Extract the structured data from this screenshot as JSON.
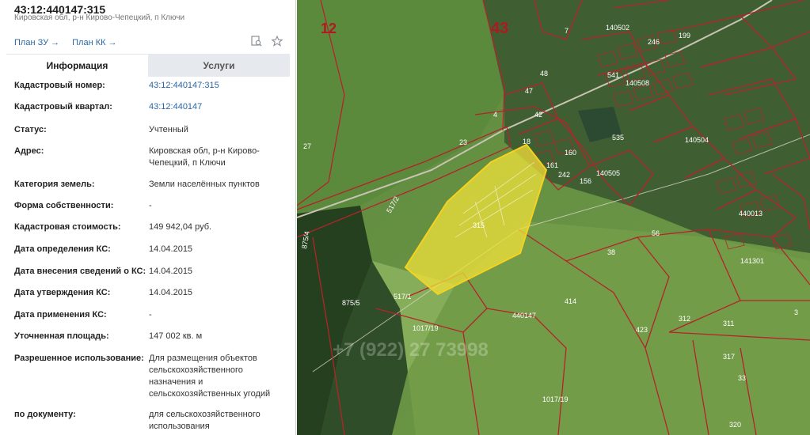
{
  "header": {
    "title": "43:12:440147:315",
    "subtitle": "Кировская обл, р-н Кирово-Чепецкий, п Ключи",
    "link_zu": "План ЗУ →",
    "link_kk": "План КК →"
  },
  "tools": {
    "search_icon": "search-doc-icon",
    "star_icon": "star-icon"
  },
  "tabs": {
    "info": "Информация",
    "services": "Услуги"
  },
  "rows": [
    {
      "key": "Кадастровый номер:",
      "value": "43:12:440147:315",
      "link": true
    },
    {
      "key": "Кадастровый квартал:",
      "value": "43:12:440147",
      "link": true
    },
    {
      "key": "Статус:",
      "value": "Учтенный"
    },
    {
      "key": "Адрес:",
      "value": "Кировская обл, р-н Кирово-Чепецкий, п Ключи"
    },
    {
      "key": "Категория земель:",
      "value": "Земли населённых пунктов"
    },
    {
      "key": "Форма собственности:",
      "value": "-"
    },
    {
      "key": "Кадастровая стоимость:",
      "value": "149 942,04 руб."
    },
    {
      "key": "Дата определения КС:",
      "value": "14.04.2015"
    },
    {
      "key": "Дата внесения сведений о КС:",
      "value": "14.04.2015"
    },
    {
      "key": "Дата утверждения КС:",
      "value": "14.04.2015"
    },
    {
      "key": "Дата применения КС:",
      "value": "-"
    },
    {
      "key": "Уточненная площадь:",
      "value": "147 002 кв. м"
    },
    {
      "key": "Разрешенное использование:",
      "value": "Для размещения объектов сельскохозяйственного назначения и сельскохозяйственных угодий"
    },
    {
      "key": "по документу:",
      "value": "для сельскохозяйственного использования"
    }
  ],
  "map": {
    "district_labels": [
      "12",
      "43"
    ],
    "quarter_labels": [
      "140502",
      "140508",
      "140504",
      "140505",
      "440013",
      "141301",
      "440147"
    ],
    "plot_labels": [
      "7",
      "48",
      "47",
      "42",
      "23",
      "27",
      "18",
      "161",
      "160",
      "156",
      "242",
      "541",
      "246",
      "199",
      "535",
      "517/2",
      "875/4",
      "875/5",
      "517/1",
      "1017/19",
      "414",
      "423",
      "312",
      "311",
      "317",
      "33",
      "1017/19",
      "320",
      "3",
      "56",
      "315",
      "38",
      "4"
    ],
    "watermark": "+7 (922) 27 73998",
    "colors": {
      "boundary": "#b5232a",
      "highlight": "#f2e23a"
    }
  }
}
